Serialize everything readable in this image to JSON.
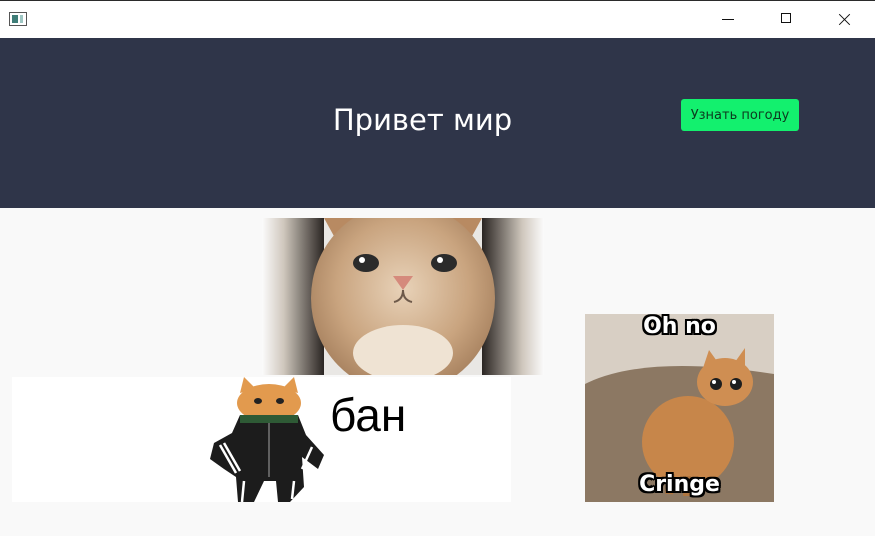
{
  "window": {
    "icon": "app-window-icon",
    "controls": [
      "minimize-icon",
      "maximize-icon",
      "close-icon"
    ]
  },
  "header": {
    "title": "Привет мир",
    "button_label": "Узнать погоду",
    "background": "#2f3549",
    "button_color": "#13f06e"
  },
  "images": {
    "cat_face": {
      "name": "cat-face-closeup-image"
    },
    "ban_meme": {
      "name": "cat-tracksuit-ban-meme",
      "text": "бан"
    },
    "ohno_meme": {
      "name": "oh-no-cringe-cat-meme",
      "top_text": "Oh no",
      "bottom_text": "Cringe"
    }
  }
}
